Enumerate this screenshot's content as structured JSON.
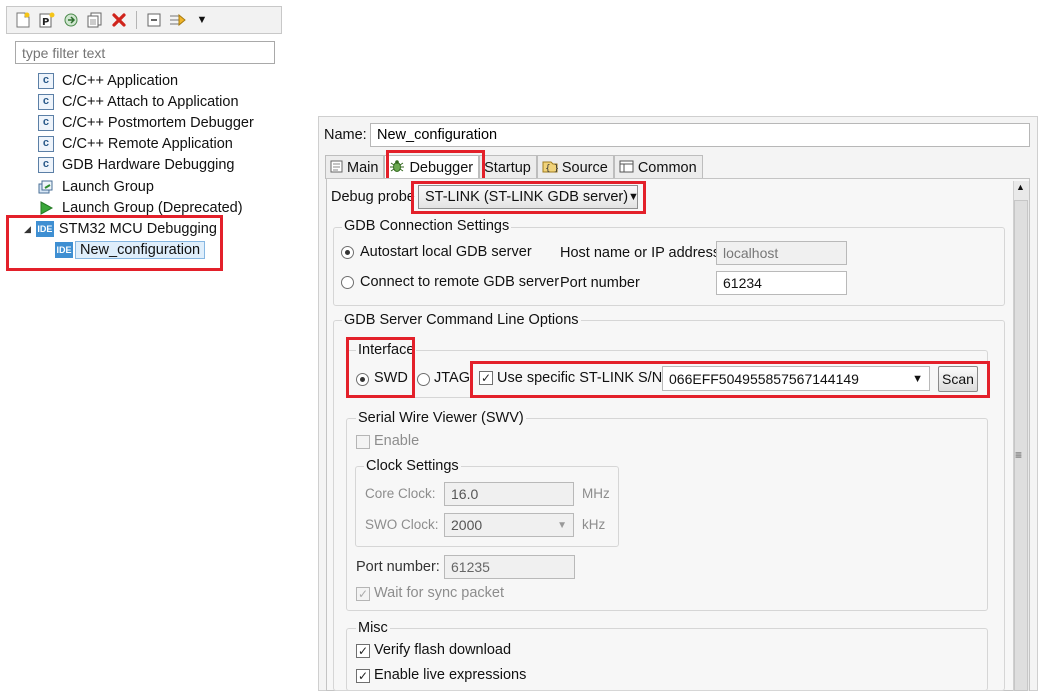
{
  "toolbar": {
    "icons": [
      "new-launch-configuration-icon",
      "new-prototype-icon",
      "export-icon",
      "duplicate-icon",
      "delete-icon",
      "collapse-all-icon",
      "filter-icon",
      "dropdown-arrow-icon"
    ]
  },
  "filter": {
    "placeholder": "type filter text"
  },
  "tree": {
    "items": [
      {
        "label": "C/C++ Application",
        "icon": "c"
      },
      {
        "label": "C/C++ Attach to Application",
        "icon": "c"
      },
      {
        "label": "C/C++ Postmortem Debugger",
        "icon": "c"
      },
      {
        "label": "C/C++ Remote Application",
        "icon": "c"
      },
      {
        "label": "GDB Hardware Debugging",
        "icon": "c"
      },
      {
        "label": "Launch Group",
        "icon": "launch-group"
      },
      {
        "label": "Launch Group (Deprecated)",
        "icon": "launch-group-deprecated"
      },
      {
        "label": "STM32 MCU Debugging",
        "icon": "IDE"
      },
      {
        "label": "New_configuration",
        "icon": "IDE"
      }
    ],
    "ide_icon_text": "IDE",
    "c_icon_text": "c"
  },
  "config": {
    "name_label": "Name:",
    "name_value": "New_configuration"
  },
  "tabs": [
    {
      "label": "Main",
      "icon": "main-tab-icon",
      "active": false
    },
    {
      "label": "Debugger",
      "icon": "debugger-bug-icon",
      "active": true
    },
    {
      "label": "Startup",
      "icon": "",
      "active": false
    },
    {
      "label": "Source",
      "icon": "source-icon",
      "active": false
    },
    {
      "label": "Common",
      "icon": "common-icon",
      "active": false
    }
  ],
  "debugger": {
    "debug_probe_label": "Debug probe",
    "debug_probe_value": "ST-LINK (ST-LINK GDB server)",
    "gdb_connection": {
      "title": "GDB Connection Settings",
      "autostart_label": "Autostart local GDB server",
      "autostart_selected": true,
      "connect_remote_label": "Connect to remote GDB server",
      "host_label": "Host name or IP address",
      "host_value": "localhost",
      "port_label": "Port number",
      "port_value": "61234"
    },
    "server_options": {
      "title": "GDB Server Command Line Options",
      "interface_label": "Interface",
      "swd_label": "SWD",
      "swd_selected": true,
      "jtag_label": "JTAG",
      "use_specific_label": "Use specific ST-LINK S/N",
      "use_specific_checked": true,
      "serial_value": "066EFF504955857567144149",
      "scan_label": "Scan"
    },
    "swv": {
      "title": "Serial Wire Viewer (SWV)",
      "enable_label": "Enable",
      "clock_title": "Clock Settings",
      "core_clock_label": "Core Clock:",
      "core_clock_value": "16.0",
      "core_clock_unit": "MHz",
      "swo_clock_label": "SWO Clock:",
      "swo_clock_value": "2000",
      "swo_clock_unit": "kHz",
      "port_label": "Port number:",
      "port_value": "61235",
      "wait_label": "Wait for sync packet",
      "wait_checked": true
    },
    "misc": {
      "title": "Misc",
      "verify_label": "Verify flash download",
      "verify_checked": true,
      "live_label": "Enable live expressions",
      "live_checked": true
    }
  },
  "colors": {
    "highlight_box": "#e3202a",
    "ide_icon": "#3f8fd2",
    "selection": "#dfeefb"
  }
}
